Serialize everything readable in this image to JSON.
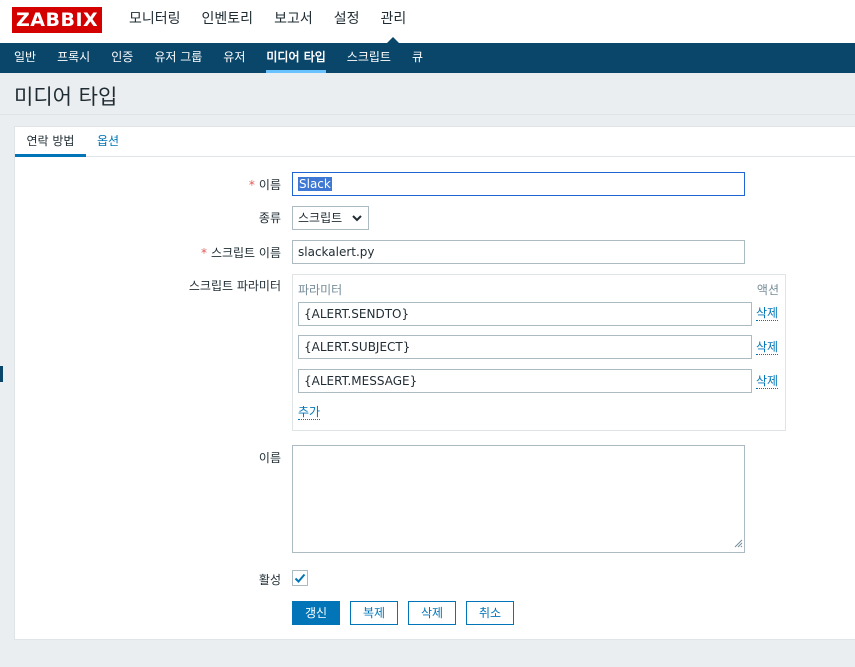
{
  "brand": {
    "logo": "ZABBIX"
  },
  "main_menu": [
    {
      "label": "모니터링"
    },
    {
      "label": "인벤토리"
    },
    {
      "label": "보고서"
    },
    {
      "label": "설정"
    },
    {
      "label": "관리",
      "active": true
    }
  ],
  "sub_menu": [
    {
      "label": "일반"
    },
    {
      "label": "프록시"
    },
    {
      "label": "인증"
    },
    {
      "label": "유저 그룹"
    },
    {
      "label": "유저"
    },
    {
      "label": "미디어 타입",
      "active": true
    },
    {
      "label": "스크립트"
    },
    {
      "label": "큐"
    }
  ],
  "page": {
    "title": "미디어 타입"
  },
  "tabs": [
    {
      "label": "연락 방법",
      "active": true
    },
    {
      "label": "옵션"
    }
  ],
  "form": {
    "name_label": "이름",
    "name_value": "Slack",
    "type_label": "종류",
    "type_value": "스크립트",
    "script_name_label": "스크립트 이름",
    "script_name_value": "slackalert.py",
    "params_label": "스크립트 파라미터",
    "params_header_param": "파라미터",
    "params_header_action": "액션",
    "params": [
      {
        "value": "{ALERT.SENDTO}",
        "remove_label": "삭제"
      },
      {
        "value": "{ALERT.SUBJECT}",
        "remove_label": "삭제"
      },
      {
        "value": "{ALERT.MESSAGE}",
        "remove_label": "삭제"
      }
    ],
    "add_label": "추가",
    "description_label": "이름",
    "description_value": "",
    "enabled_label": "활성",
    "enabled": true
  },
  "buttons": {
    "update": "갱신",
    "clone": "복제",
    "delete": "삭제",
    "cancel": "취소"
  },
  "colors": {
    "brand_red": "#d40000",
    "nav_dark": "#0a466a",
    "accent_blue": "#0275b8",
    "required": "#e45959"
  }
}
